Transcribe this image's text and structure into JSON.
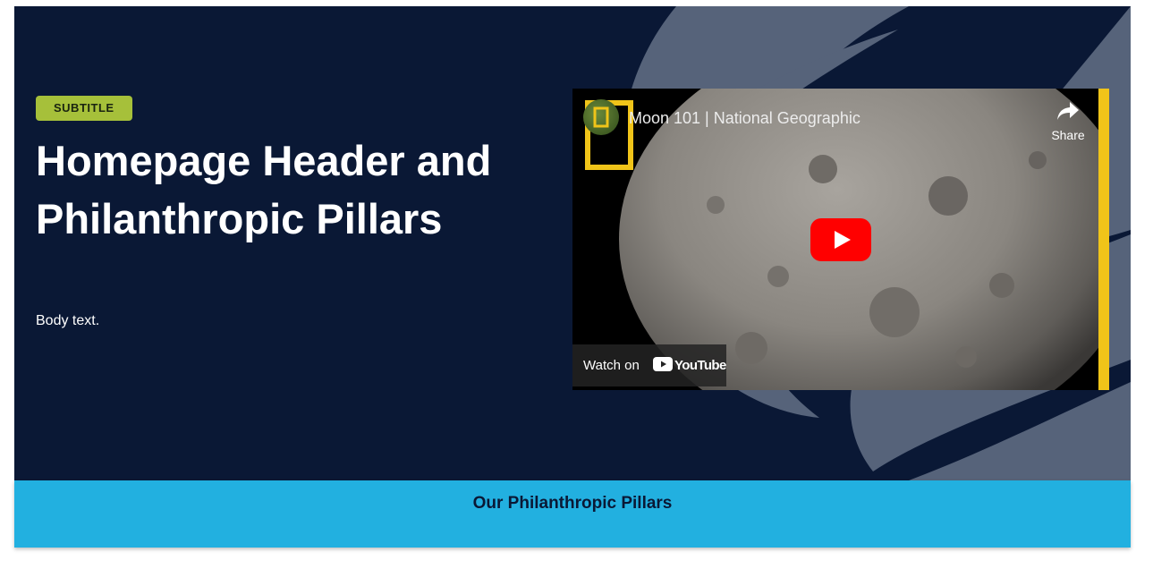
{
  "hero": {
    "subtitle": "SUBTITLE",
    "title": "Homepage Header and Philanthropic Pillars",
    "body": "Body text.",
    "background_color": "#0a1835",
    "badge_color": "#a6c03a"
  },
  "video": {
    "title": "Moon 101 | National Geographic",
    "share_label": "Share",
    "watch_on_label": "Watch on",
    "youtube_wordmark": "YouTube",
    "play_icon": "play-icon",
    "share_icon": "share-arrow-icon"
  },
  "pillars": {
    "heading": "Our Philanthropic Pillars",
    "background_color": "#22b0e0"
  }
}
